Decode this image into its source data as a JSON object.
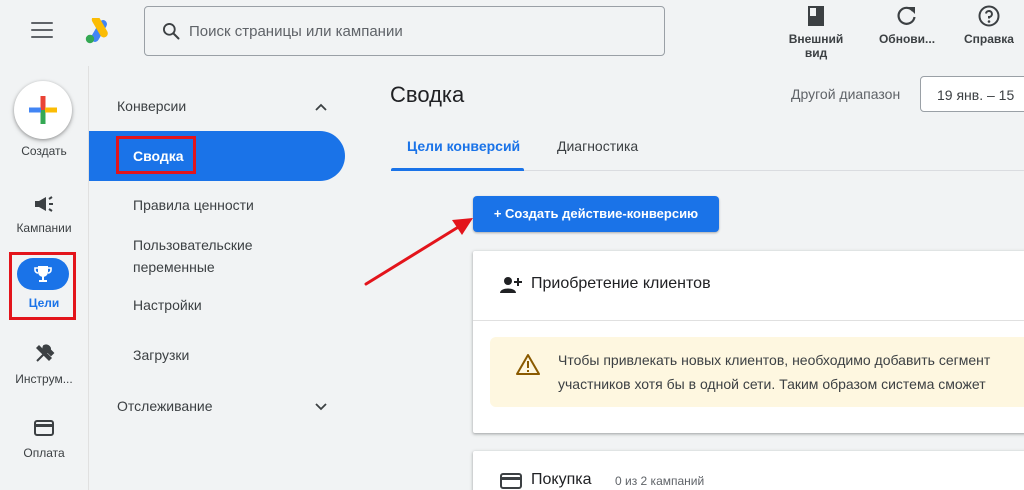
{
  "header": {
    "search_placeholder": "Поиск страницы или кампании",
    "appearance_line1": "Внешний",
    "appearance_line2": "вид",
    "refresh_label": "Обнови...",
    "help_label": "Справка"
  },
  "rail": {
    "create_label": "Создать",
    "campaigns_label": "Кампании",
    "goals_label": "Цели",
    "tools_label": "Инструм...",
    "billing_label": "Оплата"
  },
  "nav": {
    "section_conversions": "Конверсии",
    "active_item": "Сводка",
    "items": [
      "Правила ценности",
      "Пользовательские",
      "переменные",
      "Настройки",
      "Загрузки"
    ],
    "section_tracking": "Отслеживание"
  },
  "main": {
    "page_title": "Сводка",
    "range_label": "Другой диапазон",
    "date_value": "19 янв. – 15",
    "tabs": [
      {
        "label": "Цели конверсий",
        "active": true
      },
      {
        "label": "Диагностика",
        "active": false
      }
    ],
    "create_button": "+ Создать действие-конверсию",
    "card1": {
      "title": "Приобретение клиентов",
      "warning_line1": "Чтобы привлекать новых клиентов, необходимо добавить сегмент",
      "warning_line2": "участников хотя бы в одной сети. Таким образом система сможет"
    },
    "card2": {
      "title": "Покупка",
      "subtitle": "0 из 2 кампаний"
    }
  },
  "colors": {
    "accent": "#1a73e8",
    "highlight_red": "#e3141b",
    "warning_bg": "#fef7e0"
  }
}
